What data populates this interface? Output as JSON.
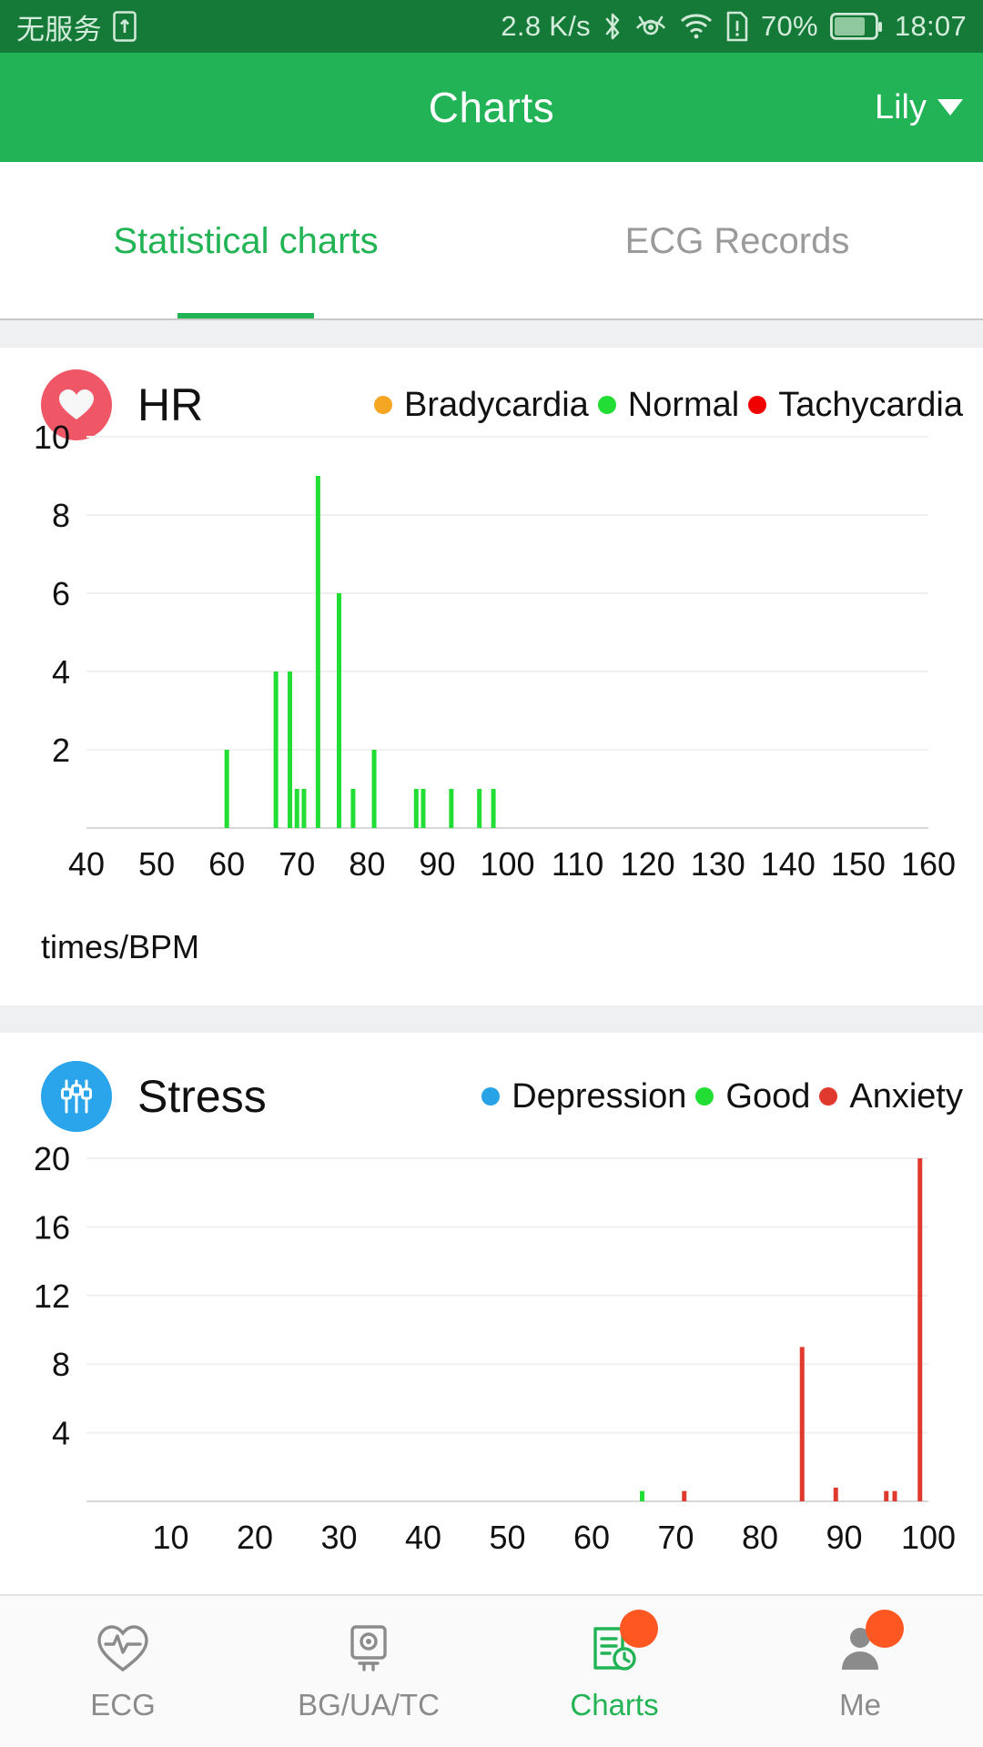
{
  "status_bar": {
    "carrier": "无服务",
    "sim_icon": "sim-card-icon",
    "network_speed": "2.8 K/s",
    "bluetooth_icon": "bluetooth-icon",
    "eye_icon": "eye-comfort-icon",
    "wifi_icon": "wifi-icon",
    "sim_alert_icon": "sim-alert-icon",
    "battery_percent": "70%",
    "battery_icon": "battery-icon",
    "time": "18:07"
  },
  "header": {
    "title": "Charts",
    "user": "Lily",
    "dropdown_icon": "chevron-down-icon"
  },
  "tabs": [
    {
      "label": "Statistical charts",
      "active": true
    },
    {
      "label": "ECG Records",
      "active": false
    }
  ],
  "colors": {
    "brand_green": "#22b357",
    "status_bar_green": "#157a38",
    "hr_icon": "#ef5767",
    "stress_icon": "#2aa4ea",
    "bradycardia": "#f5a623",
    "normal": "#22dd33",
    "tachycardia": "#f00000",
    "depression": "#29a3e8",
    "good": "#22dd33",
    "anxiety": "#e03a2f",
    "badge_orange": "#ff5722",
    "band_gray": "#eef0f2"
  },
  "chart_data": [
    {
      "type": "bar",
      "title": "HR",
      "icon": "heart-icon",
      "legend": [
        {
          "label": "Bradycardia",
          "color": "#f5a623"
        },
        {
          "label": "Normal",
          "color": "#22dd33"
        },
        {
          "label": "Tachycardia",
          "color": "#f00000"
        }
      ],
      "legend_position": "top-right",
      "xlabel": "times/BPM",
      "ylabel": "",
      "xlim": [
        40,
        160
      ],
      "ylim": [
        0,
        10
      ],
      "xticks": [
        40,
        50,
        60,
        70,
        80,
        90,
        100,
        110,
        120,
        130,
        140,
        150,
        160
      ],
      "yticks": [
        2,
        4,
        6,
        8,
        10
      ],
      "grid": true,
      "points": [
        {
          "x": 60,
          "y": 2,
          "color": "#22dd33"
        },
        {
          "x": 67,
          "y": 4,
          "color": "#22dd33"
        },
        {
          "x": 69,
          "y": 4,
          "color": "#22dd33"
        },
        {
          "x": 70,
          "y": 1,
          "color": "#22dd33"
        },
        {
          "x": 71,
          "y": 1,
          "color": "#22dd33"
        },
        {
          "x": 73,
          "y": 9,
          "color": "#22dd33"
        },
        {
          "x": 76,
          "y": 6,
          "color": "#22dd33"
        },
        {
          "x": 78,
          "y": 1,
          "color": "#22dd33"
        },
        {
          "x": 81,
          "y": 2,
          "color": "#22dd33"
        },
        {
          "x": 87,
          "y": 1,
          "color": "#22dd33"
        },
        {
          "x": 88,
          "y": 1,
          "color": "#22dd33"
        },
        {
          "x": 92,
          "y": 1,
          "color": "#22dd33"
        },
        {
          "x": 96,
          "y": 1,
          "color": "#22dd33"
        },
        {
          "x": 98,
          "y": 1,
          "color": "#22dd33"
        }
      ]
    },
    {
      "type": "bar",
      "title": "Stress",
      "icon": "sliders-icon",
      "legend": [
        {
          "label": "Depression",
          "color": "#29a3e8"
        },
        {
          "label": "Good",
          "color": "#22dd33"
        },
        {
          "label": "Anxiety",
          "color": "#e03a2f"
        }
      ],
      "legend_position": "top-right",
      "xlabel": "",
      "ylabel": "",
      "xlim": [
        0,
        100
      ],
      "ylim": [
        0,
        20
      ],
      "xticks": [
        10,
        20,
        30,
        40,
        50,
        60,
        70,
        80,
        90,
        100
      ],
      "yticks": [
        4,
        8,
        12,
        16,
        20
      ],
      "grid": true,
      "points": [
        {
          "x": 66,
          "y": 0.6,
          "color": "#22dd33"
        },
        {
          "x": 71,
          "y": 0.6,
          "color": "#e03a2f"
        },
        {
          "x": 85,
          "y": 9,
          "color": "#e03a2f"
        },
        {
          "x": 89,
          "y": 0.8,
          "color": "#e03a2f"
        },
        {
          "x": 95,
          "y": 0.6,
          "color": "#e03a2f"
        },
        {
          "x": 96,
          "y": 0.6,
          "color": "#e03a2f"
        },
        {
          "x": 99,
          "y": 20,
          "color": "#e03a2f"
        }
      ]
    }
  ],
  "bottom_nav": [
    {
      "label": "ECG",
      "icon": "ecg-heart-icon",
      "active": false,
      "badge": false
    },
    {
      "label": "BG/UA/TC",
      "icon": "glucose-meter-icon",
      "active": false,
      "badge": false
    },
    {
      "label": "Charts",
      "icon": "charts-icon",
      "active": true,
      "badge": true
    },
    {
      "label": "Me",
      "icon": "person-icon",
      "active": false,
      "badge": true
    }
  ]
}
